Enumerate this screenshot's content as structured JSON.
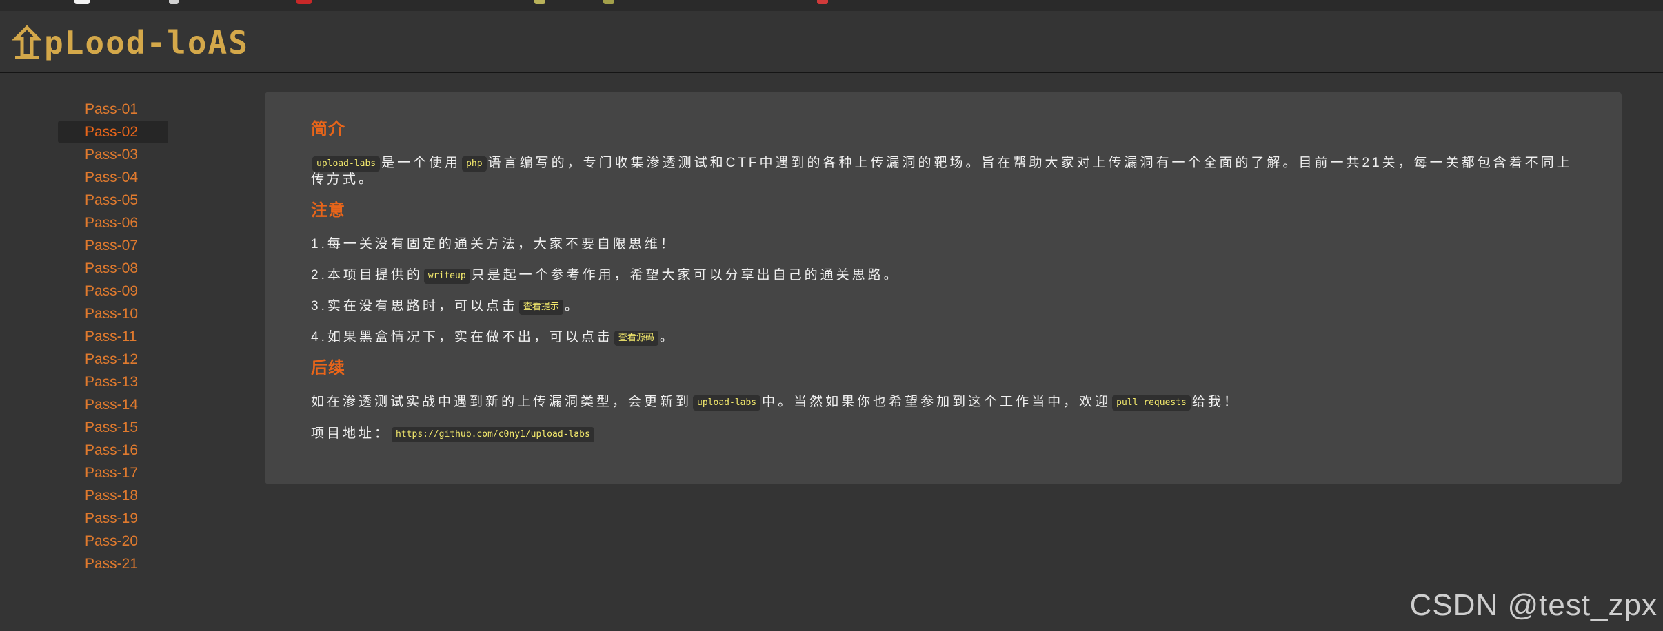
{
  "header": {
    "logo_text": "pLood-loAS"
  },
  "sidebar": {
    "items": [
      {
        "label": "Pass-01"
      },
      {
        "label": "Pass-02"
      },
      {
        "label": "Pass-03"
      },
      {
        "label": "Pass-04"
      },
      {
        "label": "Pass-05"
      },
      {
        "label": "Pass-06"
      },
      {
        "label": "Pass-07"
      },
      {
        "label": "Pass-08"
      },
      {
        "label": "Pass-09"
      },
      {
        "label": "Pass-10"
      },
      {
        "label": "Pass-11"
      },
      {
        "label": "Pass-12"
      },
      {
        "label": "Pass-13"
      },
      {
        "label": "Pass-14"
      },
      {
        "label": "Pass-15"
      },
      {
        "label": "Pass-16"
      },
      {
        "label": "Pass-17"
      },
      {
        "label": "Pass-18"
      },
      {
        "label": "Pass-19"
      },
      {
        "label": "Pass-20"
      },
      {
        "label": "Pass-21"
      }
    ],
    "active_index": 1
  },
  "intro": {
    "title": "简介",
    "tag_upload": "upload-labs",
    "text_1": "是一个使用",
    "tag_php": "php",
    "text_2": "语言编写的，专门收集渗透测试和CTF中遇到的各种上传漏洞的靶场。旨在帮助大家对上传漏洞有一个全面的了解。目前一共21关，每一关都包含着不同上传方式。"
  },
  "notice": {
    "title": "注意",
    "item1": "1.每一关没有固定的通关方法，大家不要自限思维！",
    "item2_a": "2.本项目提供的",
    "item2_tag": "writeup",
    "item2_b": "只是起一个参考作用，希望大家可以分享出自己的通关思路。",
    "item3_a": "3.实在没有思路时，可以点击",
    "item3_tag": "查看提示",
    "item3_b": "。",
    "item4_a": "4.如果黑盒情况下，实在做不出，可以点击",
    "item4_tag": "查看源码",
    "item4_b": "。"
  },
  "followup": {
    "title": "后续",
    "text_1": "如在渗透测试实战中遇到新的上传漏洞类型，会更新到",
    "tag_upload": "upload-labs",
    "text_2": "中。当然如果你也希望参加到这个工作当中，欢迎",
    "tag_pr": "pull requests",
    "text_3": "给我！",
    "addr_label": "项目地址：",
    "addr_url": "https://github.com/c0ny1/upload-labs"
  },
  "watermark": "CSDN @test_zpx",
  "colors": {
    "accent": "#e8651a",
    "link": "#e07a2e",
    "code_text": "#f2e86c",
    "logo": "#d4a84a"
  }
}
